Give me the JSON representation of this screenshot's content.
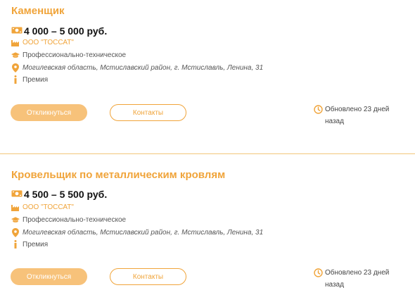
{
  "vacancies": [
    {
      "title": "Каменщик",
      "salary": "4 000 – 5 000 руб.",
      "company": "ООО \"ТОССАТ\"",
      "education": "Профессионально-техническое",
      "address": "Могилевская область, Мстиславский район, г. Мстиславль, Ленина, 31",
      "bonus": "Премия",
      "respond_label": "Откликнуться",
      "contacts_label": "Контакты",
      "updated_line1": "Обновлено 23 дней",
      "updated_line2": "назад"
    },
    {
      "title": "Кровельщик по металлическим кровлям",
      "salary": "4 500 – 5 500 руб.",
      "company": "ООО \"ТОССАТ\"",
      "education": "Профессионально-техническое",
      "address": "Могилевская область, Мстиславский район, г. Мстиславль, Ленина, 31",
      "bonus": "Премия",
      "respond_label": "Откликнуться",
      "contacts_label": "Контакты",
      "updated_line1": "Обновлено 23 дней",
      "updated_line2": "назад"
    }
  ],
  "icons": {
    "salary": "money-icon",
    "company": "factory-icon",
    "education": "graduation-cap-icon",
    "address": "location-pin-icon",
    "bonus": "info-icon",
    "updated": "clock-icon"
  },
  "colors": {
    "accent": "#f0a43a",
    "button_fill": "#f7c27a",
    "divider": "#f3c77a"
  }
}
